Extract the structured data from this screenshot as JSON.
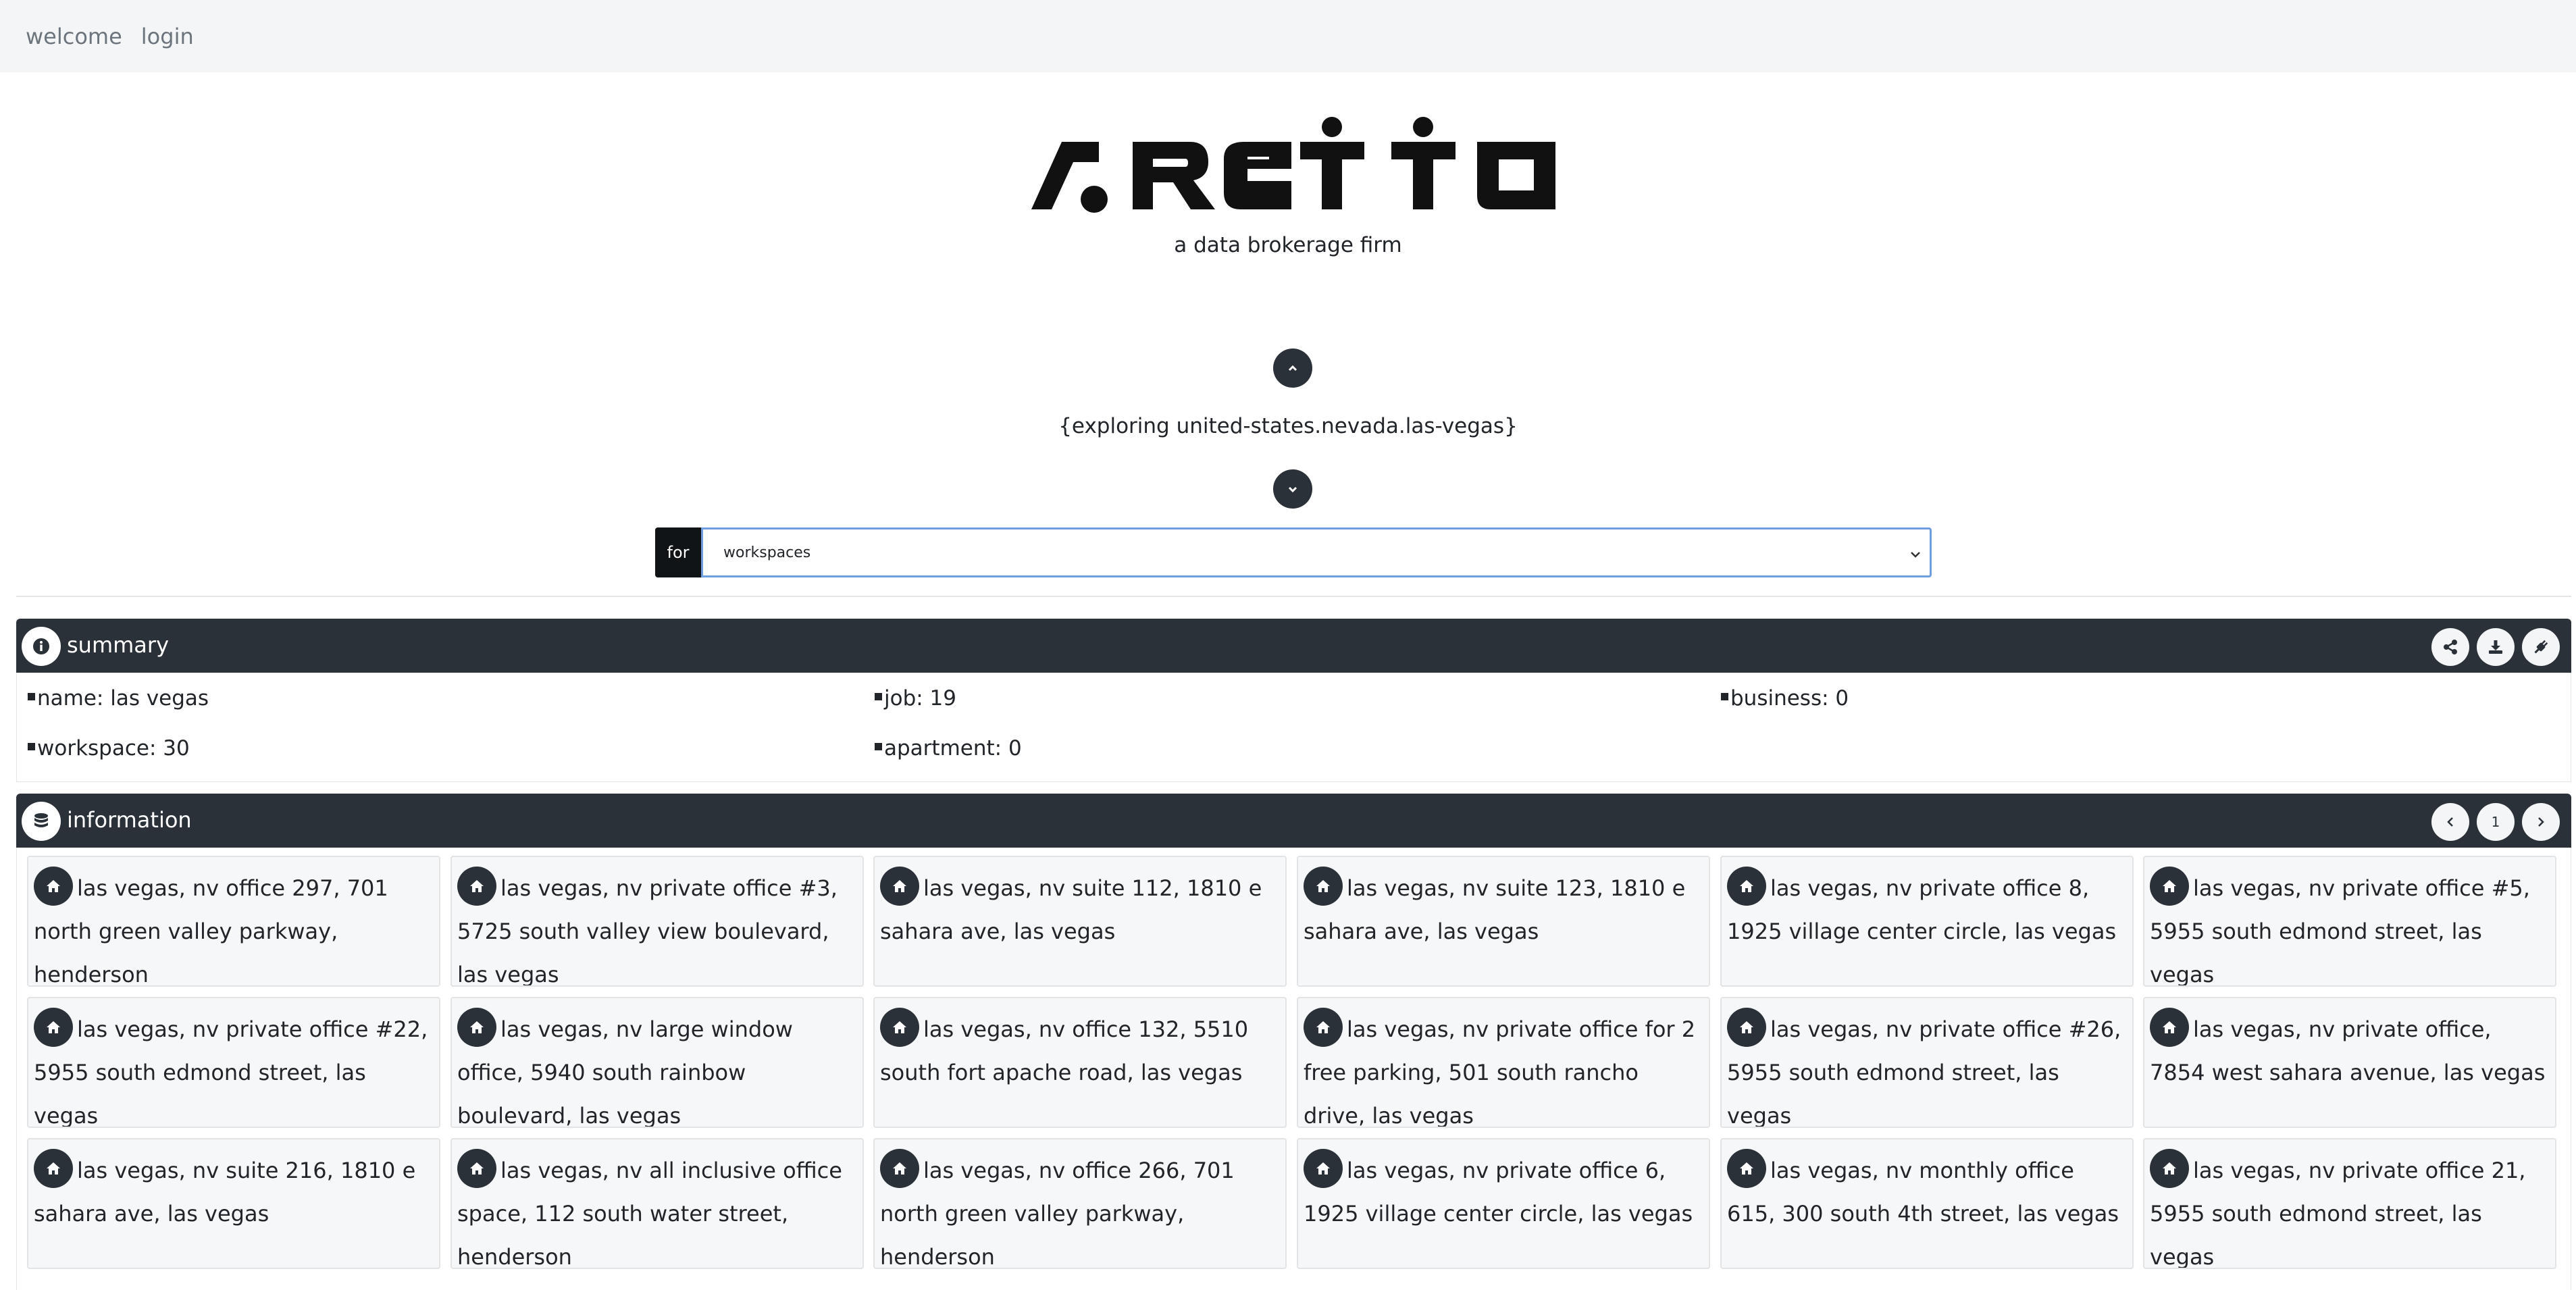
{
  "nav": {
    "welcome": "welcome",
    "login": "login"
  },
  "brand": {
    "tagline": "a data brokerage firm"
  },
  "explore": {
    "text": "{exploring united-states.nevada.las-vegas}"
  },
  "filter": {
    "label": "for",
    "selected": "workspaces"
  },
  "summary": {
    "title": "summary",
    "stats": [
      {
        "text": "name: las vegas"
      },
      {
        "text": "job: 19"
      },
      {
        "text": "business: 0"
      },
      {
        "text": "workspace: 30"
      },
      {
        "text": "apartment: 0"
      }
    ]
  },
  "information": {
    "title": "information",
    "page": "1",
    "cards": [
      {
        "text": "las vegas, nv office 297, 701 north green valley parkway, henderson"
      },
      {
        "text": "las vegas, nv private office #3, 5725 south valley view boulevard, las vegas"
      },
      {
        "text": "las vegas, nv suite 112, 1810 e sahara ave, las vegas"
      },
      {
        "text": "las vegas, nv suite 123, 1810 e sahara ave, las vegas"
      },
      {
        "text": "las vegas, nv private office 8, 1925 village center circle, las vegas"
      },
      {
        "text": "las vegas, nv private office #5, 5955 south edmond street, las vegas"
      },
      {
        "text": "las vegas, nv private office #22, 5955 south edmond street, las vegas"
      },
      {
        "text": "las vegas, nv large window office, 5940 south rainbow boulevard, las vegas"
      },
      {
        "text": "las vegas, nv office 132, 5510 south fort apache road, las vegas"
      },
      {
        "text": "las vegas, nv private office for 2 free parking, 501 south rancho drive, las vegas"
      },
      {
        "text": "las vegas, nv private office #26, 5955 south edmond street, las vegas"
      },
      {
        "text": "las vegas, nv private office, 7854 west sahara avenue, las vegas"
      },
      {
        "text": "las vegas, nv suite 216, 1810 e sahara ave, las vegas"
      },
      {
        "text": "las vegas, nv all inclusive office space, 112 south water street, henderson"
      },
      {
        "text": "las vegas, nv office 266, 701 north green valley parkway, henderson"
      },
      {
        "text": "las vegas, nv private office 6, 1925 village center circle, las vegas"
      },
      {
        "text": "las vegas, nv monthly office 615, 300 south 4th street, las vegas"
      },
      {
        "text": "las vegas, nv private office 21, 5955 south edmond street, las vegas"
      }
    ]
  },
  "icons": {
    "up": "chevron-up-icon",
    "down": "chevron-down-icon",
    "summary": "info-icon",
    "information": "database-icon",
    "card": "home-icon",
    "share": "share-icon",
    "download": "download-icon",
    "plug": "plug-icon",
    "prev": "chevron-left-icon",
    "next": "chevron-right-icon"
  },
  "colors": {
    "dark": "#2b3138",
    "navbar": "#f4f5f6",
    "card_bg": "#f6f7f8",
    "select_border": "#6f9de0"
  }
}
